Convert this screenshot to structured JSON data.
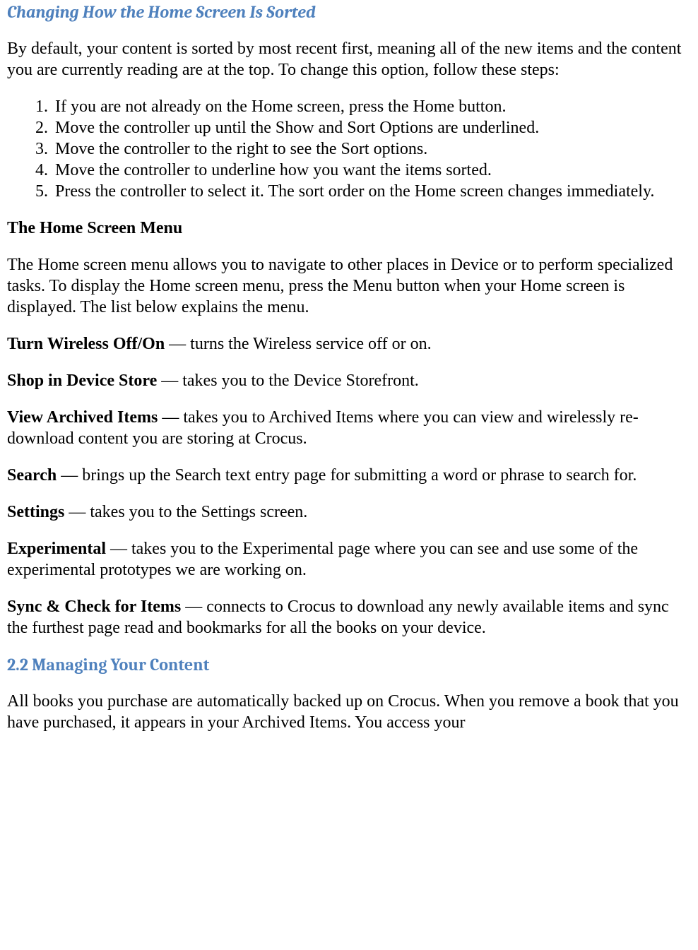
{
  "section1": {
    "title": "Changing How the Home Screen Is Sorted",
    "intro": "By default, your content is sorted by most recent first, meaning all of the new items and the content you are currently reading are at the top. To change this option, follow these steps:",
    "steps": [
      "If you are not already on the Home screen, press the Home button.",
      "Move the controller up until the Show and Sort Options are underlined.",
      "Move the controller to the right to see the Sort options.",
      "Move the controller to underline how you want the items sorted.",
      "Press the controller to select it. The sort order on the Home screen changes immediately."
    ]
  },
  "section2": {
    "title": "The Home Screen Menu",
    "intro": "The Home screen menu allows you to navigate to other places in Device or to perform specialized tasks. To display the Home screen menu, press the Menu button when your Home screen is displayed. The list below explains the menu.",
    "items": [
      {
        "term": "Turn Wireless Off/On",
        "desc": " — turns the Wireless service off or on."
      },
      {
        "term": "Shop in Device Store",
        "desc": " — takes you to the Device Storefront."
      },
      {
        "term": "View Archived Items",
        "desc": " — takes you to Archived Items where you can view and wirelessly re-download content you are storing at Crocus."
      },
      {
        "term": "Search",
        "desc": " — brings up the Search text entry page for submitting a word or phrase to search for."
      },
      {
        "term": "Settings",
        "desc": " — takes you to the Settings screen."
      },
      {
        "term": "Experimental",
        "desc": " — takes you to the Experimental page where you can see and use some of the experimental prototypes we are working on."
      },
      {
        "term": "Sync & Check for Items",
        "desc": " — connects to Crocus to download any newly available items and sync the furthest page read and bookmarks for all the books on your device."
      }
    ]
  },
  "section3": {
    "title": "2.2 Managing Your Content",
    "intro": "All books you purchase are automatically backed up on Crocus. When you remove a book that you have purchased, it appears in your Archived Items. You access your"
  }
}
